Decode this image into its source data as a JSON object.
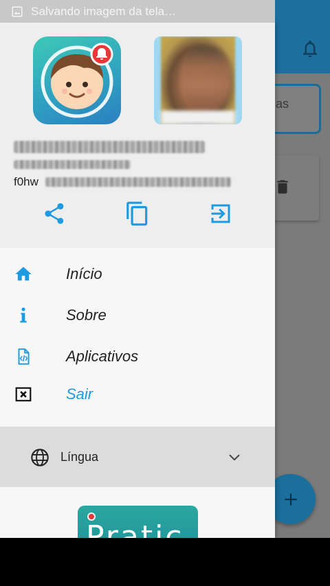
{
  "status_bar": {
    "text": "Salvando imagem da tela…"
  },
  "background": {
    "card_text": "as"
  },
  "profile": {
    "id_visible": "f0hw"
  },
  "menu": {
    "items": [
      {
        "label": "Início",
        "icon": "home-icon"
      },
      {
        "label": "Sobre",
        "icon": "info-icon"
      },
      {
        "label": "Aplicativos",
        "icon": "code-file-icon"
      },
      {
        "label": "Sair",
        "icon": "close-box-icon"
      }
    ]
  },
  "language": {
    "label": "Língua"
  },
  "footer": {
    "logo_text": "Pratic"
  },
  "colors": {
    "accent": "#1e9be0",
    "app_bar": "#1d6f9e",
    "drawer_bg": "#f7f7f7",
    "header_bg": "#eeeeee",
    "lang_bg": "#dcdcdc"
  }
}
